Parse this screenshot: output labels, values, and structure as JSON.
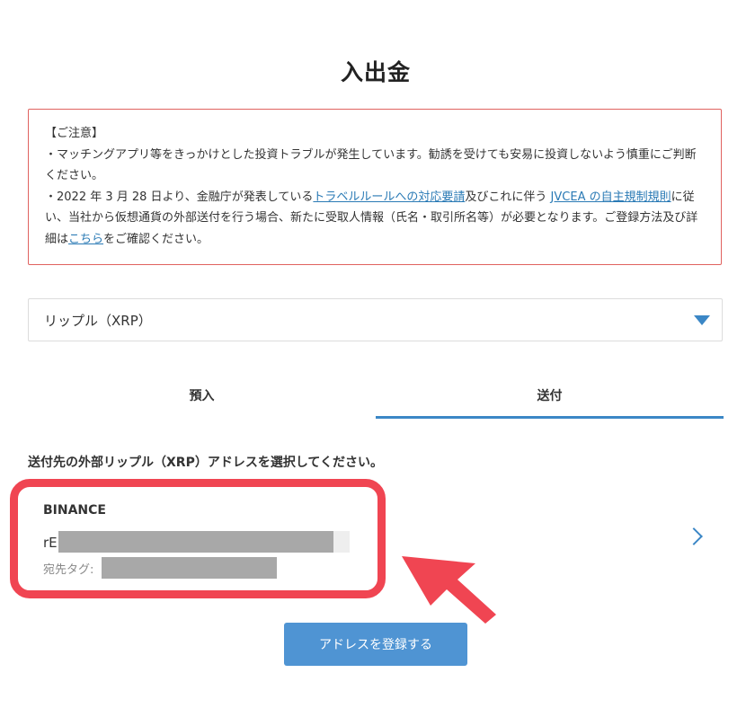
{
  "page": {
    "title": "入出金"
  },
  "notice": {
    "heading": "【ご注意】",
    "line1": "・マッチングアプリ等をきっかけとした投資トラブルが発生しています。勧誘を受けても安易に投資しないよう慎重にご判断ください。",
    "line2_prefix": "・2022 年 3 月 28 日より、金融庁が発表している",
    "link_travel_rule": "トラベルルールへの対応要請",
    "line2_middle": "及びこれに伴う ",
    "link_jvcea": "JVCEA の自主規制規則",
    "line2_suffix": "に従い、当社から仮想通貨の外部送付を行う場合、新たに受取人情報（氏名・取引所名等）が必要となります。ご登録方法及び詳細は",
    "link_here": "こちら",
    "line2_end": "をご確認ください。",
    "colors": {
      "border": "#e0625f",
      "link": "#2a7ab5"
    }
  },
  "crypto_select": {
    "selected_value": "リップル（XRP）",
    "arrow_icon": "triangle-down-icon"
  },
  "tabs": [
    {
      "label": "預入",
      "active": false
    },
    {
      "label": "送付",
      "active": true
    }
  ],
  "send": {
    "instruction": "送付先の外部リップル（XRP）アドレスを選択してください。",
    "address_card": {
      "name": "BINANCE",
      "address_prefix": "rE",
      "tag_label": "宛先タグ:",
      "chevron_icon": "chevron-right-icon"
    },
    "register_button_label": "アドレスを登録する"
  },
  "theme": {
    "accent": "#3b87c6",
    "button": "#4f94d3",
    "annotation": "#f04552"
  }
}
